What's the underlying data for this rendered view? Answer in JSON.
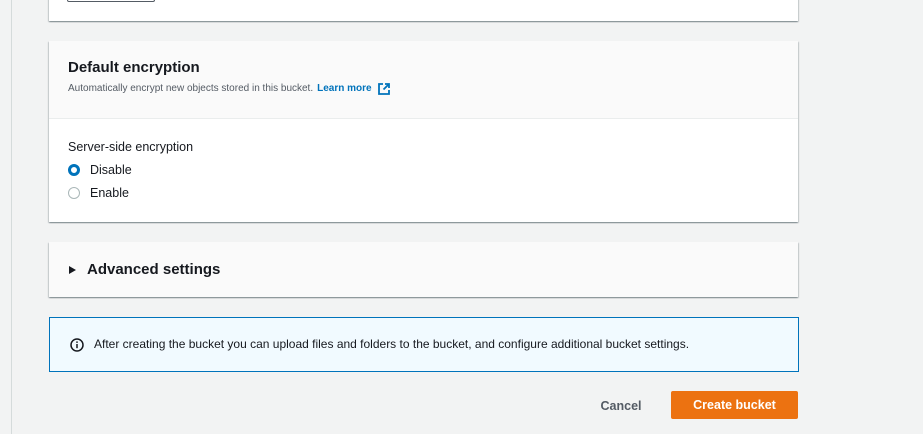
{
  "encryption": {
    "title": "Default encryption",
    "description": "Automatically encrypt new objects stored in this bucket.",
    "learn_more_label": "Learn more",
    "field_label": "Server-side encryption",
    "options": [
      {
        "label": "Disable",
        "selected": true
      },
      {
        "label": "Enable",
        "selected": false
      }
    ]
  },
  "advanced": {
    "title": "Advanced settings",
    "expanded": false
  },
  "info_alert": {
    "icon": "info-icon",
    "text": "After creating the bucket you can upload files and folders to the bucket, and configure additional bucket settings."
  },
  "actions": {
    "cancel_label": "Cancel",
    "create_label": "Create bucket"
  },
  "colors": {
    "link": "#0073bb",
    "primary_button": "#ec7211",
    "radio_selected": "#0073bb",
    "info_border": "#0073bb",
    "info_background": "#f1faff"
  }
}
